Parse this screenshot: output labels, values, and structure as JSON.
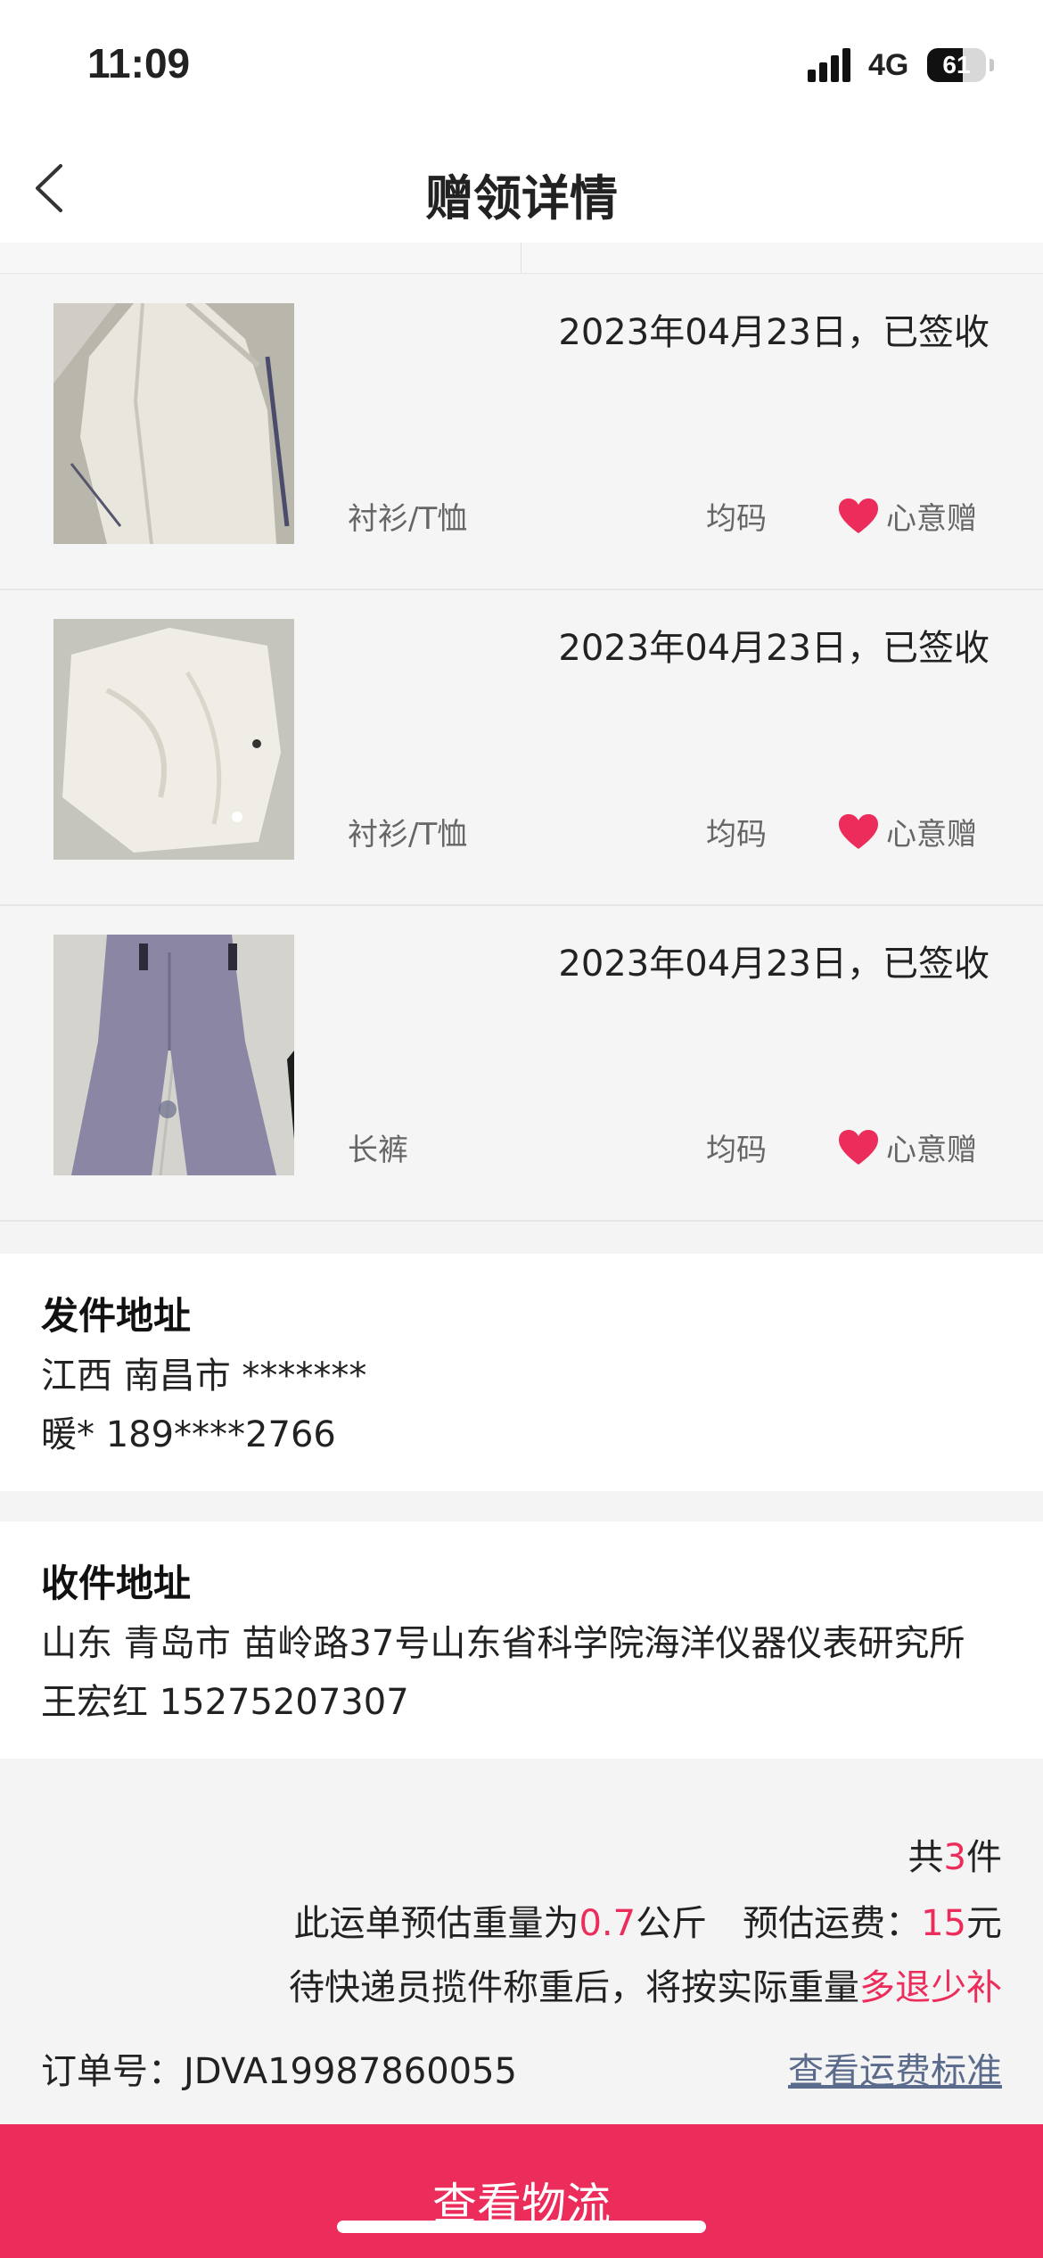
{
  "status_bar": {
    "time": "11:09",
    "network": "4G",
    "battery": "61",
    "battery_level": 0.61
  },
  "nav": {
    "title": "赠领详情"
  },
  "items": [
    {
      "status": "2023年04月23日，已签收",
      "category": "衬衫/T恤",
      "size": "均码",
      "tag": "心意赠"
    },
    {
      "status": "2023年04月23日，已签收",
      "category": "衬衫/T恤",
      "size": "均码",
      "tag": "心意赠"
    },
    {
      "status": "2023年04月23日，已签收",
      "category": "长裤",
      "size": "均码",
      "tag": "心意赠"
    }
  ],
  "sender": {
    "heading": "发件地址",
    "address": "江西 南昌市 *******",
    "contact": "暖* 189****2766"
  },
  "receiver": {
    "heading": "收件地址",
    "address": "山东 青岛市 苗岭路37号山东省科学院海洋仪器仪表研究所",
    "contact": "王宏红 15275207307"
  },
  "summary": {
    "count_prefix": "共",
    "count": "3",
    "count_suffix": "件",
    "weight_prefix": "此运单预估重量为",
    "weight": "0.7",
    "weight_unit": "公斤",
    "fee_label": "预估运费：",
    "fee": "15",
    "fee_unit": "元",
    "note_prefix": "待快递员揽件称重后，将按实际重量",
    "note_highlight": "多退少补",
    "order_label": "订单号：",
    "order_no": "JDVA19987860055",
    "fee_standard_link": "查看运费标准"
  },
  "cta": {
    "label": "查看物流"
  },
  "colors": {
    "accent": "#ec2c5a",
    "link": "#5b6b8c"
  }
}
